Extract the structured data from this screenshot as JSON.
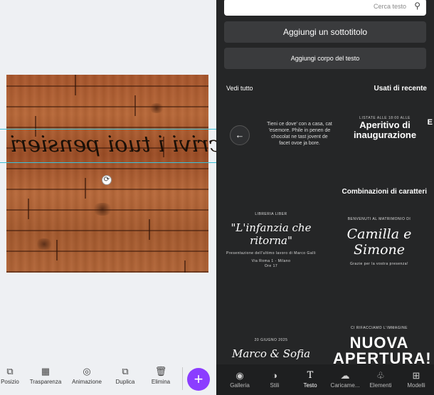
{
  "canvas": {
    "text": "Scrivi i tuoi pensieri"
  },
  "toolbar": {
    "items": [
      {
        "label": "Posizio",
        "icon": "position-icon"
      },
      {
        "label": "Trasparenza",
        "icon": "transparency-icon"
      },
      {
        "label": "Animazione",
        "icon": "animation-icon"
      },
      {
        "label": "Duplica",
        "icon": "duplicate-icon"
      },
      {
        "label": "Elimina",
        "icon": "trash-icon"
      }
    ],
    "add_label": "+"
  },
  "panel": {
    "search_placeholder": "Cerca testo",
    "add_subtitle": "Aggiungi un sottotitolo",
    "add_body": "Aggiungi corpo del testo",
    "recent_title": "Usati di recente",
    "see_all": "Vedi tutto",
    "combo_title": "Combinazioni di caratteri",
    "recent_cards": [
      {
        "small": "LISTATE ALLE 18:00 ALLE",
        "big": "Aperitivo di inaugurazione"
      },
      {
        "text": "Tieni ce dove' con a casa, cat 'esemore. Phile in penen de chocolat ne tast jovent de facet ovoe ja bore."
      }
    ],
    "edge_glyph": "E",
    "combos": [
      {
        "line1": "BENVENUTI AL MATRIMONIO DI",
        "script": "Camilla e Simone",
        "line2": "Grazie per la vostra presenza!"
      },
      {
        "line1": "LIBRERIA LIBER",
        "script": "\"L'infanzia che ritorna\"",
        "line2": "Presentazione dell'ultimo lavoro di Marco Galli",
        "line3": "Via Roma 1 - Milano",
        "line4": "Ore 17"
      },
      {
        "line1": "CI RIFACCIAMO L'IMMAGINE",
        "headline": "NUOVA APERTURA!"
      },
      {
        "line1": "20 GIUGNO 2025",
        "script": "Marco & Sofia"
      }
    ],
    "nav": [
      {
        "label": "Modelli",
        "icon": "templates-icon"
      },
      {
        "label": "Elementi",
        "icon": "elements-icon"
      },
      {
        "label": "Caricame...",
        "icon": "upload-icon"
      },
      {
        "label": "Testo",
        "icon": "text-icon"
      },
      {
        "label": "Stili",
        "icon": "styles-icon"
      },
      {
        "label": "Galleria",
        "icon": "gallery-icon"
      }
    ]
  },
  "colors": {
    "accent": "#8b3dff",
    "panel_bg": "#252627",
    "guide": "#39c0d8"
  }
}
